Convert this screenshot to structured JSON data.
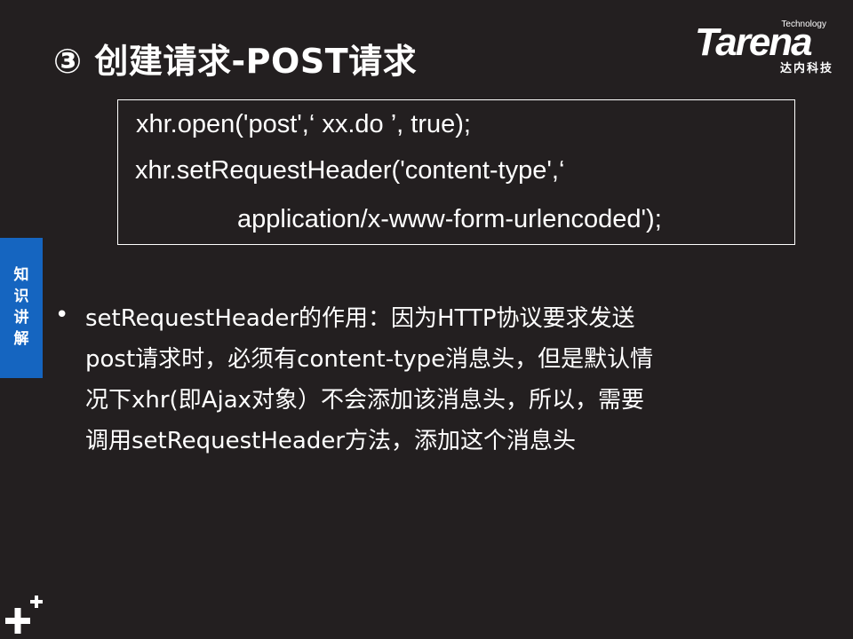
{
  "slide": {
    "title": "③ 创建请求-POST请求"
  },
  "logo": {
    "technology": "Technology",
    "brand": "Tarena",
    "cn": "达内科技"
  },
  "code": {
    "lines": [
      "xhr.open('post',‘ xx.do ’, true);",
      "xhr.setRequestHeader('content-type',‘",
      "application/x-www-form-urlencoded');"
    ]
  },
  "side_tab": {
    "label": "知识讲解",
    "color": "#1565c0"
  },
  "body": {
    "bullet": "•",
    "lines": [
      "setRequestHeader的作用：因为HTTP协议要求发送",
      "post请求时，必须有content-type消息头，但是默认情",
      "况下xhr(即Ajax对象）不会添加该消息头，所以，需要",
      "调用setRequestHeader方法，添加这个消息头"
    ]
  },
  "colors": {
    "background": "#231f20",
    "text": "#ffffff"
  }
}
